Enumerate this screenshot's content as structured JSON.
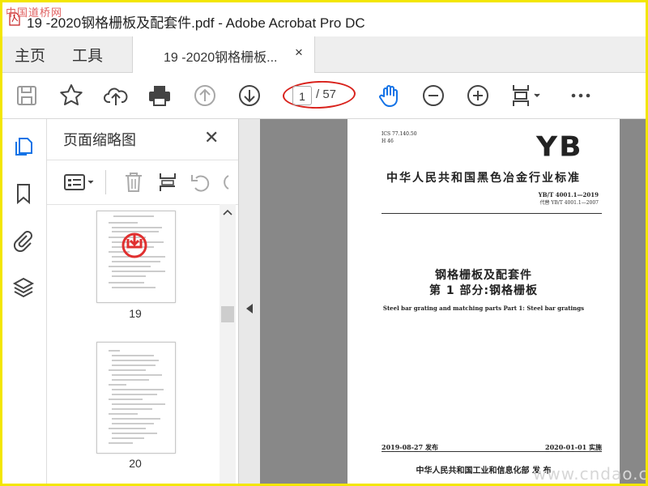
{
  "watermark_top": "中国道桥网",
  "watermark_bottom": "www.cndao.c",
  "window": {
    "title": "19 -2020钢格栅板及配套件.pdf - Adobe Acrobat Pro DC"
  },
  "tabs": {
    "home": "主页",
    "tools": "工具",
    "document": "19 -2020钢格栅板...",
    "close": "×"
  },
  "toolbar": {
    "page_current": "1",
    "page_total": "/ 57",
    "icons": [
      "save-icon",
      "star-icon",
      "cloud-upload-icon",
      "print-icon",
      "arrow-up-circle-icon",
      "arrow-down-circle-icon",
      "hand-icon",
      "zoom-out-icon",
      "zoom-in-icon",
      "fit-page-icon",
      "more-icon"
    ]
  },
  "panel": {
    "title": "页面缩略图",
    "close": "✕",
    "thumbnails": [
      {
        "label": "19"
      },
      {
        "label": "20"
      }
    ]
  },
  "document": {
    "ics_line1": "ICS 77.140.50",
    "ics_line2": "H 46",
    "logo": "YB",
    "standard_title": "中华人民共和国黑色冶金行业标准",
    "standard_number": "YB/T 4001.1—2019",
    "replaces": "代替 YB/T 4001.1—2007",
    "title_cn_1": "钢格栅板及配套件",
    "title_cn_2": "第 1 部分:钢格栅板",
    "title_en": "Steel bar grating and matching parts   Part 1: Steel bar gratings",
    "issue_date": "2019-08-27 发布",
    "implement_date": "2020-01-01 实施",
    "issuer": "中华人民共和国工业和信息化部   发 布"
  },
  "colors": {
    "accent": "#1473e6",
    "highlight_ellipse": "#d9221c",
    "border": "#f3e600"
  }
}
